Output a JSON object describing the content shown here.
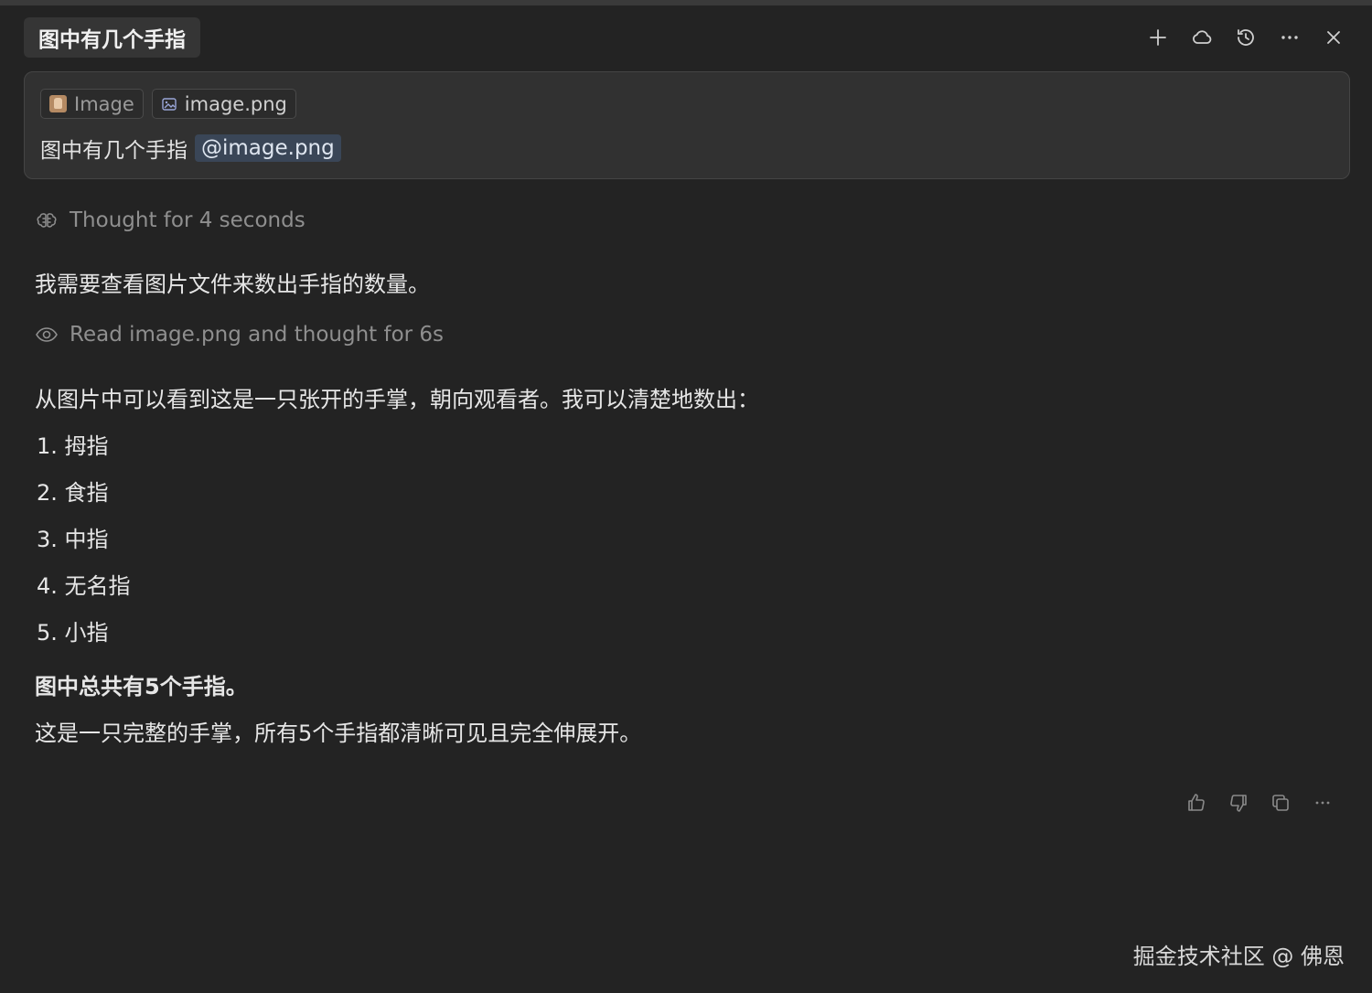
{
  "header": {
    "title": "图中有几个手指",
    "actions": [
      {
        "name": "new-chat",
        "icon": "plus-icon"
      },
      {
        "name": "cloud",
        "icon": "cloud-icon"
      },
      {
        "name": "history",
        "icon": "history-icon"
      },
      {
        "name": "more",
        "icon": "more-horizontal-icon"
      },
      {
        "name": "close",
        "icon": "close-icon"
      }
    ]
  },
  "prompt": {
    "chips": [
      {
        "label": "Image",
        "icon": "image-thumbnail-icon"
      },
      {
        "label": "image.png",
        "icon": "image-file-icon"
      }
    ],
    "text": "图中有几个手指",
    "mention": "@image.png"
  },
  "response": {
    "thought_status": "Thought for 4 seconds",
    "intro": "我需要查看图片文件来数出手指的数量。",
    "read_status": "Read image.png and thought for 6s",
    "observation": "从图片中可以看到这是一只张开的手掌，朝向观看者。我可以清楚地数出：",
    "fingers": [
      "1. 拇指",
      "2. 食指",
      "3. 中指",
      "4. 无名指",
      "5. 小指"
    ],
    "conclusion": "图中总共有5个手指。",
    "detail": "这是一只完整的手掌，所有5个手指都清晰可见且完全伸展开。"
  },
  "feedback": [
    {
      "icon": "thumbs-up-icon"
    },
    {
      "icon": "thumbs-down-icon"
    },
    {
      "icon": "copy-icon"
    },
    {
      "icon": "more-horizontal-icon"
    }
  ],
  "watermark": "掘金技术社区 @ 佛恩"
}
